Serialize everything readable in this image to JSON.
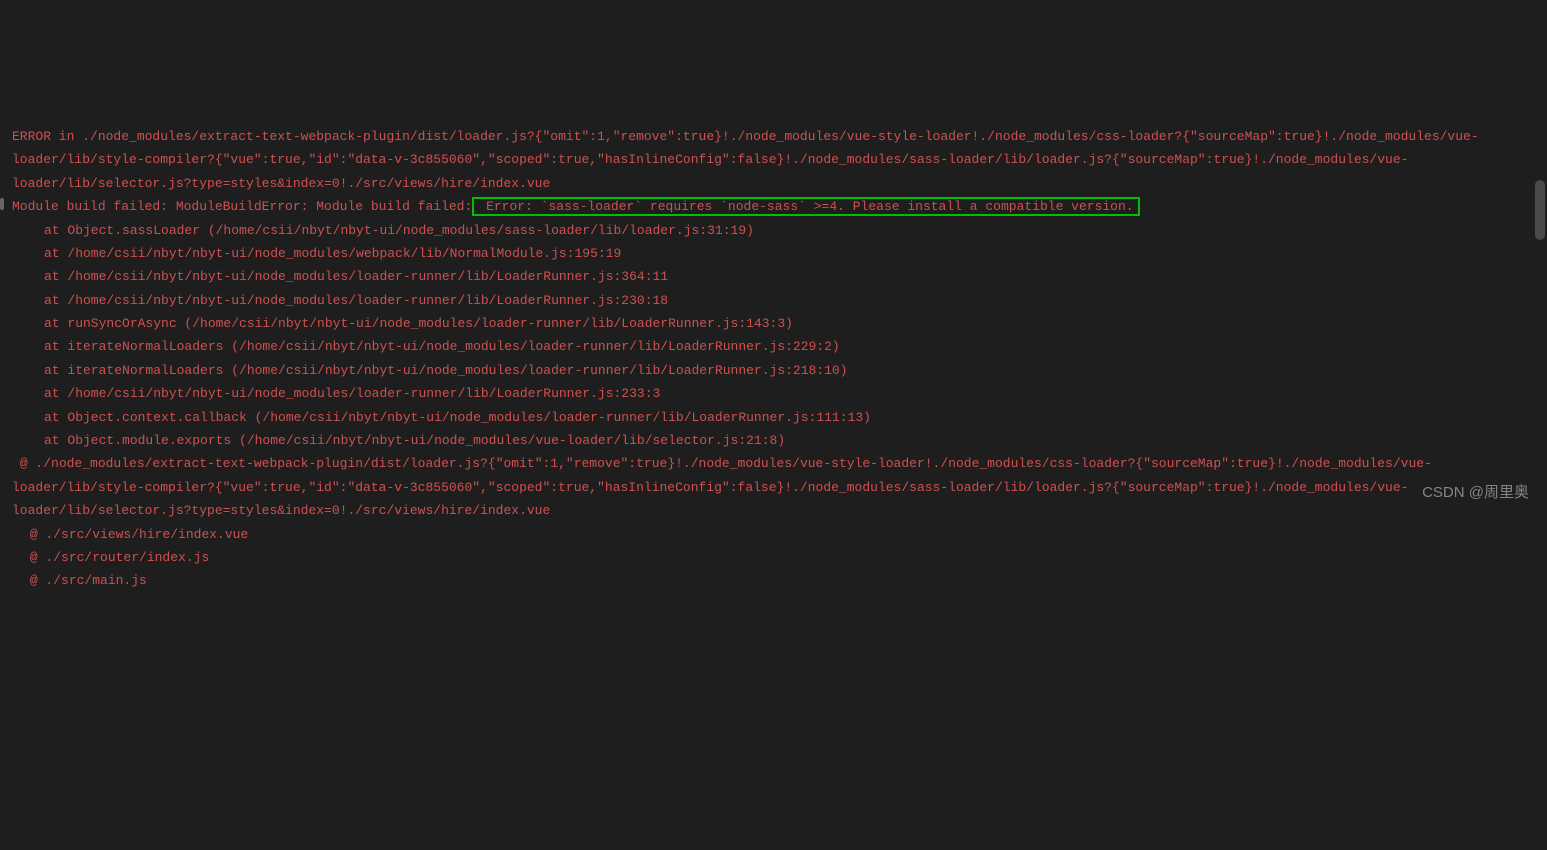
{
  "error": {
    "header_lines": [
      "ERROR in ./node_modules/extract-text-webpack-plugin/dist/loader.js?{\"omit\":1,\"remove\":true}!./node_modules/vue-style-loader!./node_modules/css-loader?{\"sourceMap\":true}!./node_modules/vue-loader/lib/style-compiler?{\"vue\":true,\"id\":\"data-v-3c855060\",\"scoped\":true,\"hasInlineConfig\":false}!./node_modules/sass-loader/lib/loader.js?{\"sourceMap\":true}!./node_modules/vue-loader/lib/selector.js?type=styles&index=0!./src/views/hire/index.vue"
    ],
    "module_failed_prefix": "Module build failed: ModuleBuildError: Module build failed:",
    "highlighted_message": " Error: `sass-loader` requires `node-sass` >=4. Please install a compatible version.",
    "stack_lines": [
      "at Object.sassLoader (/home/csii/nbyt/nbyt-ui/node_modules/sass-loader/lib/loader.js:31:19)",
      "at /home/csii/nbyt/nbyt-ui/node_modules/webpack/lib/NormalModule.js:195:19",
      "at /home/csii/nbyt/nbyt-ui/node_modules/loader-runner/lib/LoaderRunner.js:364:11",
      "at /home/csii/nbyt/nbyt-ui/node_modules/loader-runner/lib/LoaderRunner.js:230:18",
      "at runSyncOrAsync (/home/csii/nbyt/nbyt-ui/node_modules/loader-runner/lib/LoaderRunner.js:143:3)",
      "at iterateNormalLoaders (/home/csii/nbyt/nbyt-ui/node_modules/loader-runner/lib/LoaderRunner.js:229:2)",
      "at iterateNormalLoaders (/home/csii/nbyt/nbyt-ui/node_modules/loader-runner/lib/LoaderRunner.js:218:10)",
      "at /home/csii/nbyt/nbyt-ui/node_modules/loader-runner/lib/LoaderRunner.js:233:3",
      "at Object.context.callback (/home/csii/nbyt/nbyt-ui/node_modules/loader-runner/lib/LoaderRunner.js:111:13)",
      "at Object.module.exports (/home/csii/nbyt/nbyt-ui/node_modules/vue-loader/lib/selector.js:21:8)"
    ],
    "at_chain_lines": [
      " @ ./node_modules/extract-text-webpack-plugin/dist/loader.js?{\"omit\":1,\"remove\":true}!./node_modules/vue-style-loader!./node_modules/css-loader?{\"sourceMap\":true}!./node_modules/vue-loader/lib/style-compiler?{\"vue\":true,\"id\":\"data-v-3c855060\",\"scoped\":true,\"hasInlineConfig\":false}!./node_modules/sass-loader/lib/loader.js?{\"sourceMap\":true}!./node_modules/vue-loader/lib/selector.js?type=styles&index=0!./src/views/hire/index.vue",
      " @ ./src/views/hire/index.vue",
      " @ ./src/router/index.js",
      " @ ./src/main.js"
    ]
  },
  "watermark": "CSDN @周里奥"
}
